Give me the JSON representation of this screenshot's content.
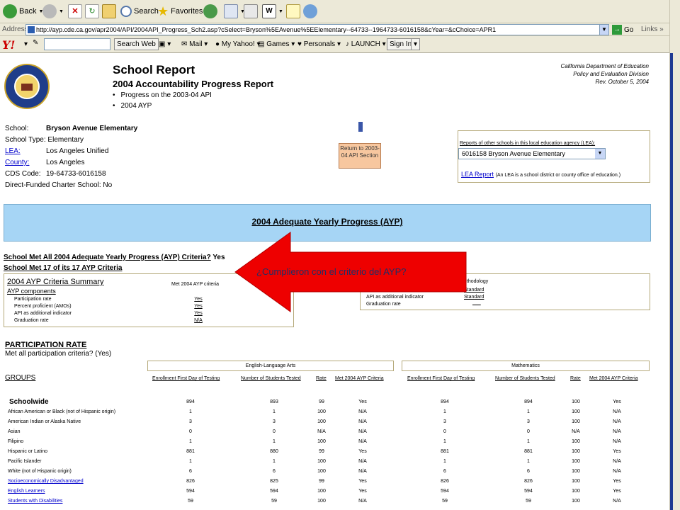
{
  "browser": {
    "toolbar": {
      "back": "Back",
      "search": "Search",
      "favorites": "Favorites"
    },
    "address": {
      "label": "Address",
      "url": "http://ayp.cde.ca.gov/apr2004/API/2004API_Progress_Sch2.asp?cSelect=Bryson%5EAvenue%5EElementary--64733--1964733-6016158&cYear=&cChoice=APR1",
      "go": "Go",
      "links": "Links"
    },
    "yahoo_bar": {
      "logo": "Y!",
      "search_web": "Search Web",
      "mail": "Mail",
      "my_yahoo": "My Yahoo!",
      "games": "Games",
      "personals": "Personals",
      "launch": "LAUNCH",
      "sign_in": "Sign In"
    }
  },
  "header": {
    "title": "School Report",
    "subtitle": "2004 Accountability Progress Report",
    "bullets": [
      "Progress on the 2003-04 API",
      "2004 AYP"
    ],
    "agency": [
      "California Department of Education",
      "Policy and Evaluation Division",
      "Rev. October 5, 2004"
    ]
  },
  "school_info": [
    {
      "label": "School:",
      "value": "Bryson Avenue Elementary",
      "bold": true
    },
    {
      "label": "School Type:",
      "value": "Elementary"
    },
    {
      "label": "LEA:",
      "value": "Los Angeles Unified",
      "link": true
    },
    {
      "label": "County:",
      "value": "Los Angeles",
      "link": true
    },
    {
      "label": "CDS Code:",
      "value": "19-64733-6016158"
    },
    {
      "label": "Direct-Funded Charter School:",
      "value": "No"
    }
  ],
  "return_button": "Return to 2003-04 API Section",
  "lea_panel": {
    "caption": "Reports of other schools in this local education agency (LEA):",
    "selected": "6016158 Bryson Avenue Elementary",
    "link": "LEA Report",
    "note": "(An LEA is a school district or county office of education.)"
  },
  "ayp_banner": "2004 Adequate Yearly Progress (AYP)",
  "met_all": {
    "text": "School Met All 2004 Adequate Yearly Progress (AYP) Criteria?",
    "answer": "Yes"
  },
  "met_count": "School Met  17  of its  17  AYP Criteria",
  "criteria_summary": {
    "title": "2004 AYP Criteria Summary",
    "components": "AYP components",
    "met_col": "Met 2004 AYP criteria",
    "rows": [
      {
        "label": "Participation rate",
        "value": "Yes"
      },
      {
        "label": "Percent proficient (AMOs)",
        "value": "Yes"
      },
      {
        "label": "API as additional indicator",
        "value": "Yes"
      },
      {
        "label": "Graduation rate",
        "value": "N/A"
      }
    ]
  },
  "methodology": {
    "header": "ethodology",
    "rows": [
      {
        "label": "",
        "value": "Standard"
      },
      {
        "label": "API as additional indicator",
        "value": "Standard"
      },
      {
        "label": "Graduation rate",
        "value": "___"
      }
    ]
  },
  "annotation": "¿Cumplieron con el criterio del AYP?",
  "participation": {
    "title": "PARTICIPATION RATE",
    "sub": "Met all participation criteria? (Yes)",
    "subject_ela": "English-Language Arts",
    "subject_math": "Mathematics",
    "groups_label": "GROUPS",
    "columns": [
      "Enrollment First Day of Testing",
      "Number of Students Tested",
      "Rate",
      "Met 2004 AYP Criteria",
      "Enrollment First Day of Testing",
      "Number of Students Tested",
      "Rate",
      "Met 2004 AYP Criteria"
    ],
    "rows": [
      {
        "group": "Schoolwide",
        "style": "big",
        "v": [
          "894",
          "893",
          "99",
          "Yes",
          "894",
          "894",
          "100",
          "Yes"
        ]
      },
      {
        "group": "African American or Black (not of Hispanic origin)",
        "v": [
          "1",
          "1",
          "100",
          "N/A",
          "1",
          "1",
          "100",
          "N/A"
        ]
      },
      {
        "group": "American Indian or Alaska Native",
        "v": [
          "3",
          "3",
          "100",
          "N/A",
          "3",
          "3",
          "100",
          "N/A"
        ]
      },
      {
        "group": "Asian",
        "v": [
          "0",
          "0",
          "N/A",
          "N/A",
          "0",
          "0",
          "N/A",
          "N/A"
        ]
      },
      {
        "group": "Filipino",
        "v": [
          "1",
          "1",
          "100",
          "N/A",
          "1",
          "1",
          "100",
          "N/A"
        ]
      },
      {
        "group": "Hispanic or Latino",
        "v": [
          "881",
          "880",
          "99",
          "Yes",
          "881",
          "881",
          "100",
          "Yes"
        ]
      },
      {
        "group": "Pacific Islander",
        "v": [
          "1",
          "1",
          "100",
          "N/A",
          "1",
          "1",
          "100",
          "N/A"
        ]
      },
      {
        "group": "White (not of Hispanic origin)",
        "v": [
          "6",
          "6",
          "100",
          "N/A",
          "6",
          "6",
          "100",
          "N/A"
        ]
      },
      {
        "group": "Socioeconomically Disadvantaged",
        "style": "link",
        "v": [
          "826",
          "825",
          "99",
          "Yes",
          "826",
          "826",
          "100",
          "Yes"
        ]
      },
      {
        "group": "English Learners",
        "style": "link",
        "v": [
          "594",
          "594",
          "100",
          "Yes",
          "594",
          "594",
          "100",
          "Yes"
        ]
      },
      {
        "group": "Students with Disabilities",
        "style": "link",
        "v": [
          "59",
          "59",
          "100",
          "N/A",
          "59",
          "59",
          "100",
          "N/A"
        ]
      }
    ]
  }
}
